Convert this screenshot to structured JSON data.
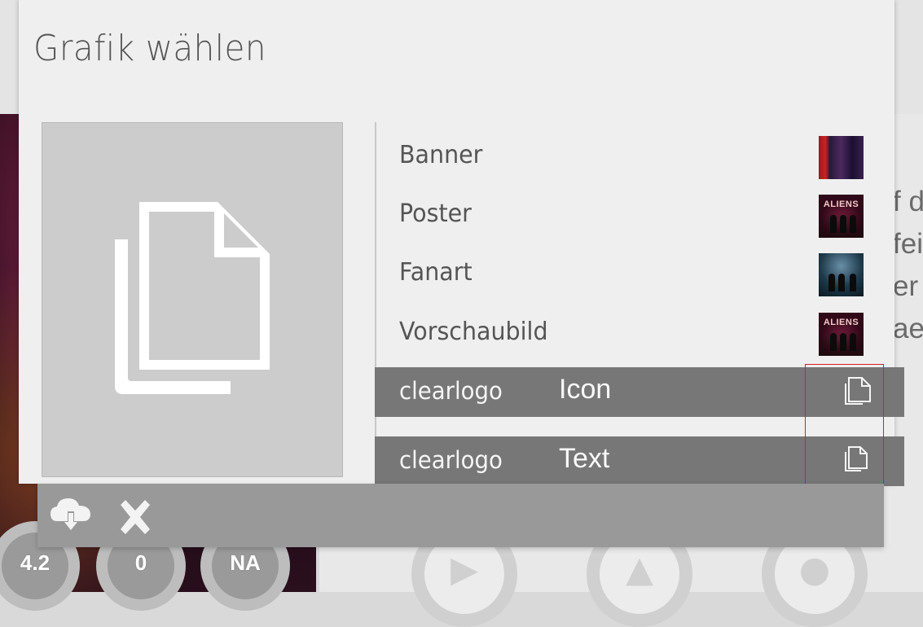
{
  "dialog": {
    "title": "Grafik wählen"
  },
  "preview": {
    "icon": "copy-file-icon"
  },
  "art_types": [
    {
      "label": "Banner",
      "thumb": "banner-thumbnail"
    },
    {
      "label": "Poster",
      "thumb": "poster-thumbnail"
    },
    {
      "label": "Fanart",
      "thumb": "fanart-thumbnail"
    },
    {
      "label": "Vorschaubild",
      "thumb": "thumb-thumbnail"
    }
  ],
  "thumb_text": {
    "poster": "ALIENS",
    "thumb": "ALIENS"
  },
  "logo_rows": [
    {
      "label": "clearlogo",
      "type": "Icon",
      "icon": "copy-file-icon"
    },
    {
      "label": "clearlogo",
      "type": "Text",
      "icon": "copy-file-icon"
    }
  ],
  "footer": {
    "download_icon": "cloud-download-icon",
    "close_icon": "close-icon"
  },
  "background": {
    "description_fragments": [
      "f d",
      "fei",
      "er",
      "ae"
    ],
    "ratings": [
      "4.2",
      "0",
      "NA"
    ]
  },
  "colors": {
    "dialog_bg": "#efefef",
    "selected_row_bg": "#777777",
    "footer_bg": "#999999",
    "highlight_border": "#d62020"
  }
}
